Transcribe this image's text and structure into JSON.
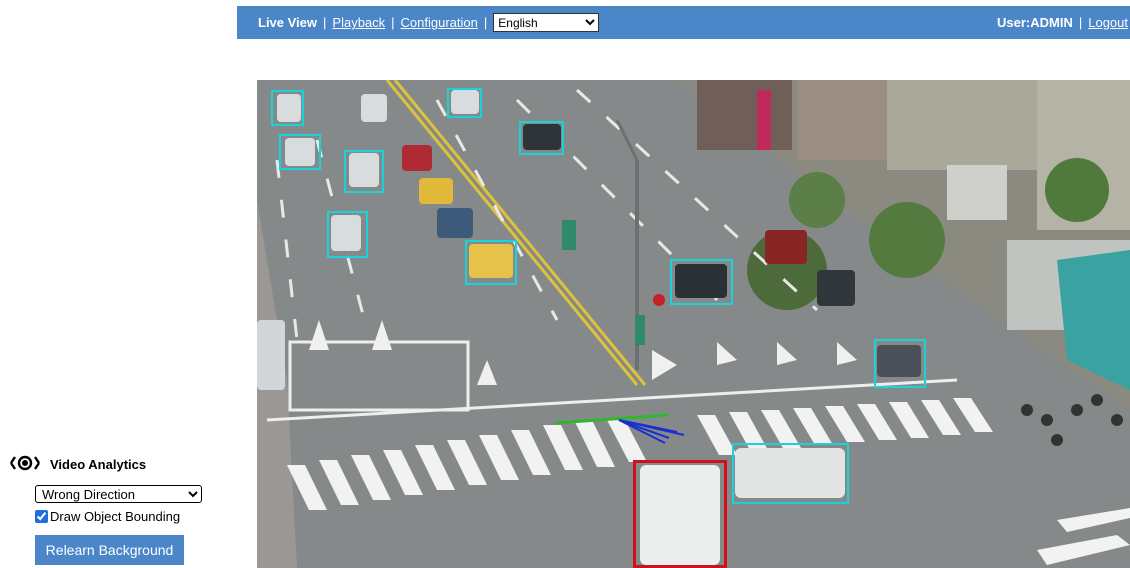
{
  "nav": {
    "live_view": "Live View",
    "playback": "Playback",
    "configuration": "Configuration",
    "language_selected": "English",
    "user": "User:ADMIN",
    "logout": "Logout",
    "separator": "|"
  },
  "analytics": {
    "title": "Video Analytics",
    "mode_selected": "Wrong Direction",
    "draw_bounding_label": "Draw Object Bounding",
    "draw_bounding_checked": true,
    "relearn_label": "Relearn Background"
  },
  "video": {
    "tracked_object_count": 12,
    "alert_object_count": 1,
    "colors": {
      "tracked_box": "#1ad3d8",
      "alert_box": "#d0111b",
      "direction_line": "#2fb82f",
      "direction_arrows": "#1a2fd0",
      "nav_bar": "#4a86c8"
    }
  }
}
